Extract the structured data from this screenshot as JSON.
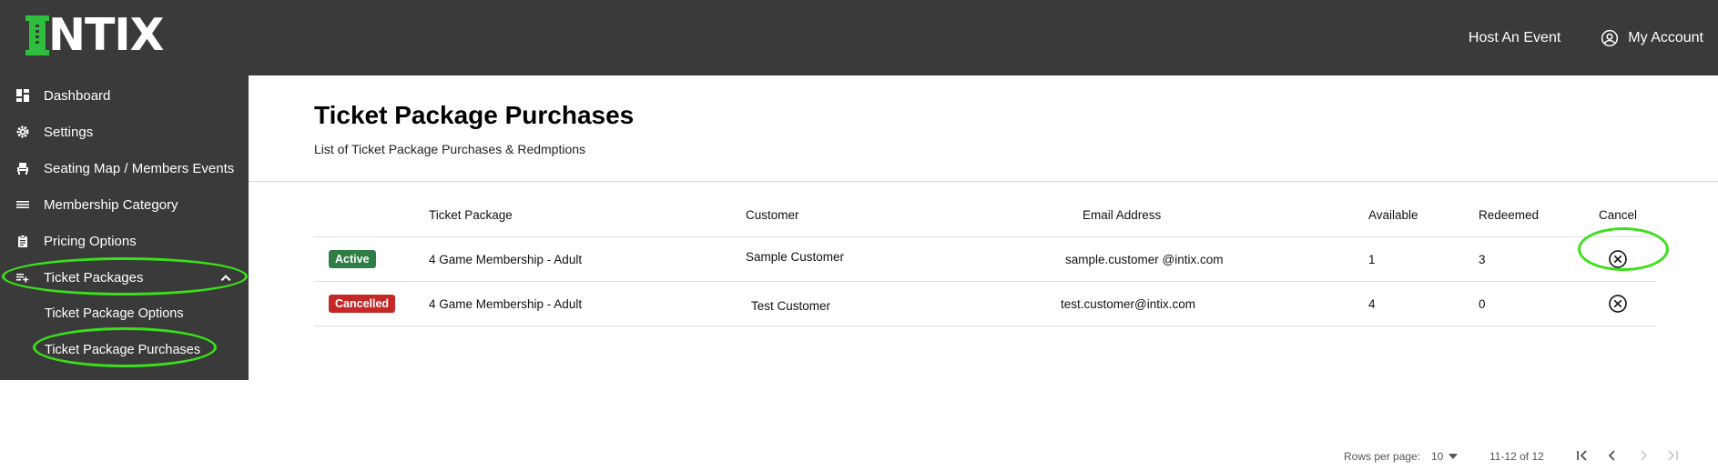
{
  "header": {
    "logo_accent": "I",
    "logo_rest": "NTIX",
    "host_link": "Host An Event",
    "account_link": "My Account",
    "colors": {
      "bar": "#3a3a3a",
      "logo": "#2fbf3f",
      "highlight_ring": "#3be01a"
    }
  },
  "sidebar": {
    "items": [
      {
        "label": "Dashboard",
        "icon": "dashboard-icon"
      },
      {
        "label": "Settings",
        "icon": "gear-icon"
      },
      {
        "label": "Seating Map / Members Events",
        "icon": "seat-icon"
      },
      {
        "label": "Membership Category",
        "icon": "menu-lines-icon"
      },
      {
        "label": "Pricing Options",
        "icon": "clipboard-icon"
      },
      {
        "label": "Ticket Packages",
        "icon": "playlist-add-icon",
        "expanded": true
      }
    ],
    "sub_items": [
      {
        "label": "Ticket Package Options"
      },
      {
        "label": "Ticket Package Purchases",
        "selected": true
      }
    ]
  },
  "main": {
    "title": "Ticket Package Purchases",
    "subtitle": "List of Ticket Package Purchases & Redmptions",
    "table": {
      "columns": [
        "",
        "Ticket Package",
        "Customer",
        "Email Address",
        "Available",
        "Redeemed",
        "Cancel"
      ],
      "rows": [
        {
          "status": "Active",
          "package": "4 Game Membership - Adult",
          "customer": "Sample Customer",
          "email": "sample.customer @intix.com",
          "available": "1",
          "redeemed": "3"
        },
        {
          "status": "Cancelled",
          "package": "4 Game Membership - Adult",
          "customer": "Test Customer",
          "email": "test.customer@intix.com",
          "available": "4",
          "redeemed": "0"
        }
      ]
    },
    "pagination": {
      "rows_per_page_label": "Rows per page:",
      "rows_per_page": "10",
      "range": "11-12 of 12"
    }
  }
}
